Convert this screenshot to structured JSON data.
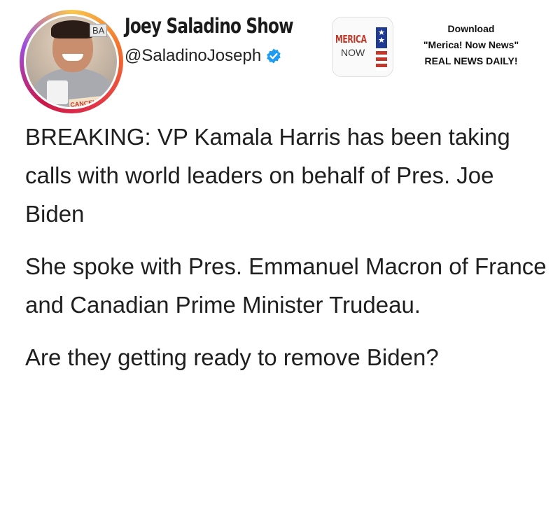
{
  "profile": {
    "name": "Joey Saladino Show",
    "handle": "@SaladinoJoseph",
    "avatar_tag": "BA",
    "avatar_sticker": "CANCELLED",
    "verified_color": "#1d9bf0"
  },
  "ad": {
    "logo_merica": "MERICA",
    "logo_now": "NOW",
    "line1": "Download",
    "line2": "\"Merica! Now News\"",
    "line3": "REAL NEWS DAILY!"
  },
  "post": {
    "paragraphs": [
      "BREAKING: VP Kamala Harris has been taking calls with world leaders on behalf of Pres. Joe Biden",
      "She spoke with Pres. Emmanuel Macron of France and Canadian Prime Minister Trudeau.",
      "Are they getting ready to remove Biden?"
    ]
  }
}
